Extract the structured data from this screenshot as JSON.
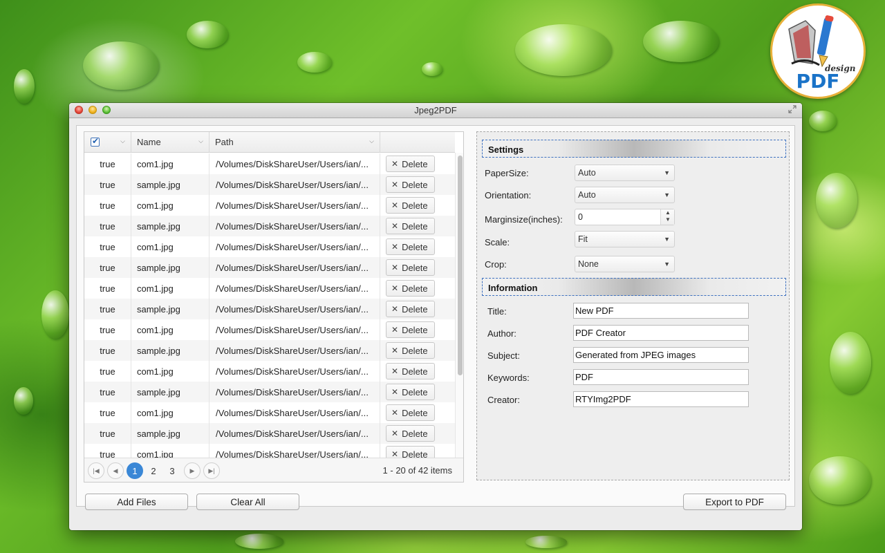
{
  "window": {
    "title": "Jpeg2PDF"
  },
  "logo": {
    "text": "PDF",
    "subtext": "design"
  },
  "table": {
    "columns": [
      "",
      "Name",
      "Path",
      ""
    ],
    "delete_label": "Delete",
    "rows": [
      {
        "selected": "true",
        "name": "com1.jpg",
        "path": "/Volumes/DiskShareUser/Users/ian/..."
      },
      {
        "selected": "true",
        "name": "sample.jpg",
        "path": "/Volumes/DiskShareUser/Users/ian/..."
      },
      {
        "selected": "true",
        "name": "com1.jpg",
        "path": "/Volumes/DiskShareUser/Users/ian/..."
      },
      {
        "selected": "true",
        "name": "sample.jpg",
        "path": "/Volumes/DiskShareUser/Users/ian/..."
      },
      {
        "selected": "true",
        "name": "com1.jpg",
        "path": "/Volumes/DiskShareUser/Users/ian/..."
      },
      {
        "selected": "true",
        "name": "sample.jpg",
        "path": "/Volumes/DiskShareUser/Users/ian/..."
      },
      {
        "selected": "true",
        "name": "com1.jpg",
        "path": "/Volumes/DiskShareUser/Users/ian/..."
      },
      {
        "selected": "true",
        "name": "sample.jpg",
        "path": "/Volumes/DiskShareUser/Users/ian/..."
      },
      {
        "selected": "true",
        "name": "com1.jpg",
        "path": "/Volumes/DiskShareUser/Users/ian/..."
      },
      {
        "selected": "true",
        "name": "sample.jpg",
        "path": "/Volumes/DiskShareUser/Users/ian/..."
      },
      {
        "selected": "true",
        "name": "com1.jpg",
        "path": "/Volumes/DiskShareUser/Users/ian/..."
      },
      {
        "selected": "true",
        "name": "sample.jpg",
        "path": "/Volumes/DiskShareUser/Users/ian/..."
      },
      {
        "selected": "true",
        "name": "com1.jpg",
        "path": "/Volumes/DiskShareUser/Users/ian/..."
      },
      {
        "selected": "true",
        "name": "sample.jpg",
        "path": "/Volumes/DiskShareUser/Users/ian/..."
      },
      {
        "selected": "true",
        "name": "com1.jpg",
        "path": "/Volumes/DiskShareUser/Users/ian/..."
      }
    ]
  },
  "pager": {
    "pages": [
      "1",
      "2",
      "3"
    ],
    "current_page": "1",
    "info": "1 - 20 of 42 items",
    "icons": [
      "first-page-icon",
      "prev-page-icon",
      "next-page-icon",
      "last-page-icon"
    ]
  },
  "settings": {
    "section_title": "Settings",
    "paper_size": {
      "label": "PaperSize:",
      "value": "Auto"
    },
    "orientation": {
      "label": "Orientation:",
      "value": "Auto"
    },
    "margin": {
      "label": "Marginsize(inches):",
      "value": "0"
    },
    "scale": {
      "label": "Scale:",
      "value": "Fit"
    },
    "crop": {
      "label": "Crop:",
      "value": "None"
    }
  },
  "information": {
    "section_title": "Information",
    "title": {
      "label": "Title:",
      "value": "New PDF"
    },
    "author": {
      "label": "Author:",
      "value": "PDF Creator"
    },
    "subject": {
      "label": "Subject:",
      "value": "Generated from JPEG images"
    },
    "keywords": {
      "label": "Keywords:",
      "value": "PDF"
    },
    "creator": {
      "label": "Creator:",
      "value": "RTYImg2PDF"
    }
  },
  "actions": {
    "add_files": "Add Files",
    "clear_all": "Clear All",
    "export": "Export to PDF"
  },
  "colors": {
    "accent": "#3a87d6",
    "section_border": "#3b6fbf",
    "logo_text": "#1a73c8"
  }
}
